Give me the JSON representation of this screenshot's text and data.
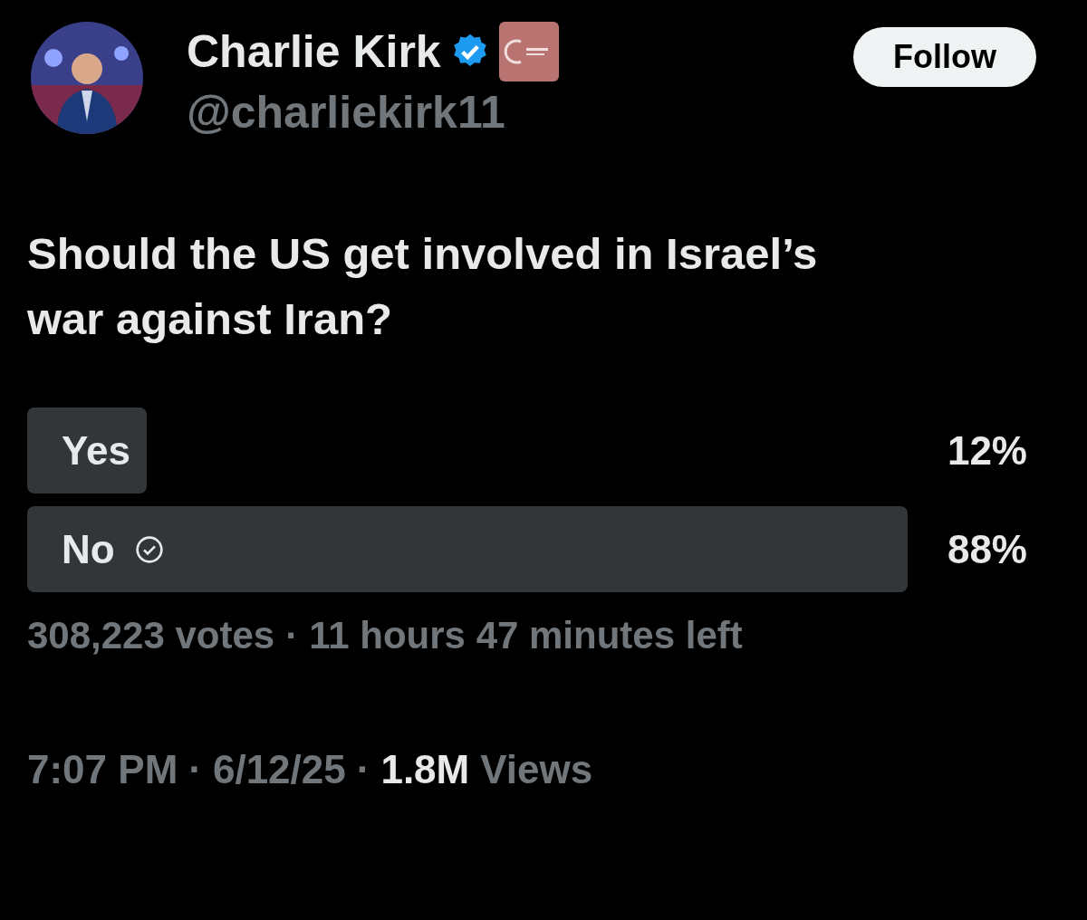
{
  "author": {
    "name": "Charlie Kirk",
    "verified": true,
    "handle": "@charliekirk11"
  },
  "follow_button": "Follow",
  "question": "Should the US get involved in Israel’s war against Iran?",
  "poll": {
    "options": [
      {
        "label": "Yes",
        "percent": "12%",
        "level": 0.12,
        "selected": false
      },
      {
        "label": "No",
        "percent": "88%",
        "level": 0.88,
        "selected": true
      }
    ],
    "votes": "308,223 votes",
    "separator": "·",
    "time_left": "11 hours 47 minutes left"
  },
  "meta": {
    "time": "7:07 PM",
    "date": "6/12/25",
    "views": "1.8M",
    "views_label": "Views",
    "separator": "·"
  }
}
